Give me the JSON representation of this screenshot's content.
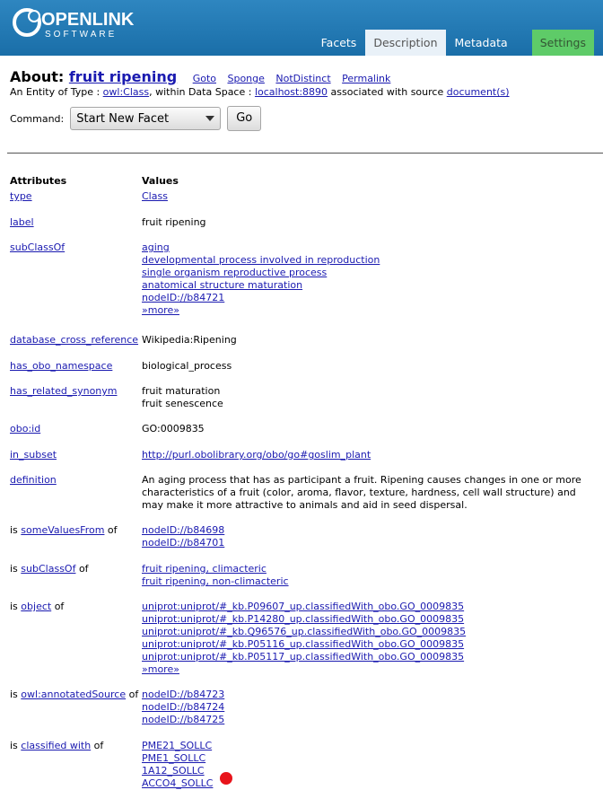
{
  "brand": {
    "line1": "OPENLINK",
    "line2": "SOFTWARE"
  },
  "tabs": [
    "Facets",
    "Description",
    "Metadata",
    "Settings"
  ],
  "about": {
    "prefix": "About:",
    "title": "fruit ripening",
    "nav": [
      "Goto",
      "Sponge",
      "NotDistinct",
      "Permalink"
    ]
  },
  "entity": {
    "t1": "An Entity of Type : ",
    "type": "owl:Class",
    "t2": ", within Data Space : ",
    "space": "localhost:8890",
    "t3": " associated with source ",
    "source": "document(s)"
  },
  "command": {
    "label": "Command:",
    "selected": "Start New Facet",
    "go": "Go"
  },
  "table": {
    "col_attr": "Attributes",
    "col_vals": "Values",
    "rows": [
      {
        "pre": "",
        "attr": "type",
        "post": "",
        "values": [
          {
            "t": "Class",
            "link": true
          }
        ]
      },
      {
        "pre": "",
        "attr": "label",
        "post": "",
        "values": [
          {
            "t": "fruit ripening",
            "link": false
          }
        ]
      },
      {
        "pre": "",
        "attr": "subClassOf",
        "post": "",
        "values": [
          {
            "t": "aging",
            "link": true
          },
          {
            "t": "developmental process involved in reproduction",
            "link": true
          },
          {
            "t": "single organism reproductive process",
            "link": true
          },
          {
            "t": "anatomical structure maturation",
            "link": true
          },
          {
            "t": "nodeID://b84721",
            "link": true
          },
          {
            "t": "»more»",
            "link": true
          }
        ]
      },
      {
        "pre": "",
        "attr": "database_cross_reference",
        "post": "",
        "values": [
          {
            "t": "Wikipedia:Ripening",
            "link": false
          }
        ]
      },
      {
        "pre": "",
        "attr": "has_obo_namespace",
        "post": "",
        "values": [
          {
            "t": "biological_process",
            "link": false
          }
        ]
      },
      {
        "pre": "",
        "attr": "has_related_synonym",
        "post": "",
        "values": [
          {
            "t": "fruit maturation",
            "link": false
          },
          {
            "t": "fruit senescence",
            "link": false
          }
        ]
      },
      {
        "pre": "",
        "attr": "obo:id",
        "post": "",
        "values": [
          {
            "t": "GO:0009835",
            "link": false
          }
        ]
      },
      {
        "pre": "",
        "attr": "in_subset",
        "post": "",
        "values": [
          {
            "t": "http://purl.obolibrary.org/obo/go#goslim_plant",
            "link": true
          }
        ]
      },
      {
        "pre": "",
        "attr": "definition",
        "post": "",
        "values": [
          {
            "t": "An aging process that has as participant a fruit. Ripening causes changes in one or more characteristics of a fruit (color, aroma, flavor, texture, hardness, cell wall structure) and may make it more attractive to animals and aid in seed dispersal.",
            "link": false,
            "para": true
          }
        ]
      },
      {
        "pre": "is ",
        "attr": "someValuesFrom",
        "post": " of",
        "values": [
          {
            "t": "nodeID://b84698",
            "link": true
          },
          {
            "t": "nodeID://b84701",
            "link": true
          }
        ]
      },
      {
        "pre": "is ",
        "attr": "subClassOf",
        "post": " of",
        "values": [
          {
            "t": "fruit ripening, climacteric",
            "link": true
          },
          {
            "t": "fruit ripening, non-climacteric",
            "link": true
          }
        ]
      },
      {
        "pre": "is ",
        "attr": "object",
        "post": " of",
        "values": [
          {
            "t": "uniprot:uniprot/#_kb.P09607_up.classifiedWith_obo.GO_0009835",
            "link": true
          },
          {
            "t": "uniprot:uniprot/#_kb.P14280_up.classifiedWith_obo.GO_0009835",
            "link": true
          },
          {
            "t": "uniprot:uniprot/#_kb.Q96576_up.classifiedWith_obo.GO_0009835",
            "link": true
          },
          {
            "t": "uniprot:uniprot/#_kb.P05116_up.classifiedWith_obo.GO_0009835",
            "link": true
          },
          {
            "t": "uniprot:uniprot/#_kb.P05117_up.classifiedWith_obo.GO_0009835",
            "link": true
          },
          {
            "t": "»more»",
            "link": true
          }
        ]
      },
      {
        "pre": "is ",
        "attr": "owl:annotatedSource",
        "post": " of",
        "values": [
          {
            "t": "nodeID://b84723",
            "link": true
          },
          {
            "t": "nodeID://b84724",
            "link": true
          },
          {
            "t": "nodeID://b84725",
            "link": true
          }
        ]
      },
      {
        "pre": "is ",
        "attr": "classified with",
        "post": " of",
        "values": [
          {
            "t": "PME21_SOLLC",
            "link": true
          },
          {
            "t": "PME1_SOLLC",
            "link": true
          },
          {
            "t": "1A12_SOLLC",
            "link": true
          },
          {
            "t": "ACCO4_SOLLC",
            "link": true
          }
        ]
      }
    ]
  },
  "colors": {
    "header": "#1f78b4",
    "settings_tab": "#5ecb68",
    "link": "#1a1ab0",
    "dot": "#e8141b"
  }
}
